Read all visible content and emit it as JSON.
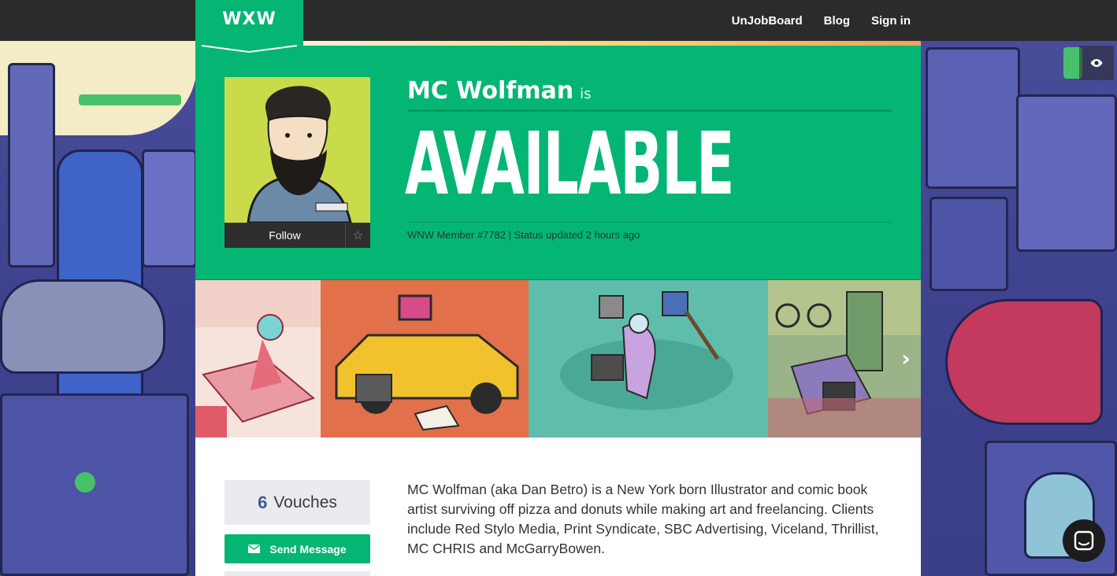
{
  "nav": {
    "logo": "WXW",
    "links": [
      "UnJobBoard",
      "Blog",
      "Sign in"
    ]
  },
  "profile": {
    "name": "MC Wolfman",
    "is_word": "is",
    "status": "AVAILABLE",
    "meta": "WNW Member #7782 | Status updated 2 hours ago",
    "follow_label": "Follow"
  },
  "vouches": {
    "count": "6",
    "label": "Vouches"
  },
  "actions": {
    "send_message": "Send Message"
  },
  "bio": "MC Wolfman (aka Dan Betro) is a New York born Illustrator and comic book artist surviving off pizza and donuts while making art and freelancing. Clients include Red Stylo Media, Print Syndicate, SBC Advertising, Viceland, Thrillist, MC CHRIS and McGarryBowen.",
  "colors": {
    "brand_green": "#05b574",
    "topbar": "#2b2b2b"
  },
  "icons": {
    "star": "star-icon",
    "eye": "eye-icon",
    "envelope": "envelope-icon",
    "next": "chevron-right-icon",
    "chat": "chat-icon"
  }
}
